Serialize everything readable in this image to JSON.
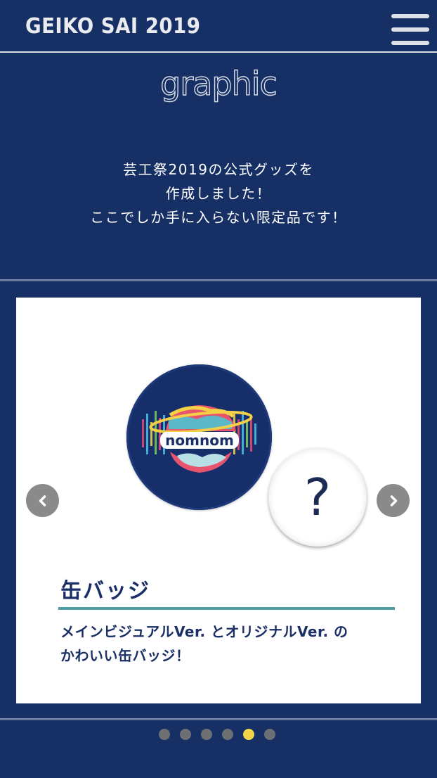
{
  "header": {
    "site_title": "GEIKO SAI 2019",
    "menu_icon": "hamburger-menu-icon"
  },
  "section": {
    "heading": "graphic",
    "intro_lines": [
      "芸工祭2019の公式グッズを",
      "作成しました！",
      "ここでしか手に入らない限定品です！"
    ]
  },
  "carousel": {
    "prev_icon": "chevron-left-icon",
    "next_icon": "chevron-right-icon",
    "item": {
      "badge_text": "nomnom",
      "mystery_symbol": "?",
      "title": "缶バッジ",
      "description_lines": [
        "メインビジュアルVer. とオリジナルVer. の",
        "かわいい缶バッジ！"
      ]
    },
    "total_slides": 6,
    "active_slide": 5
  },
  "colors": {
    "background": "#163066",
    "accent_rule": "#4e9ea5",
    "active_dot": "#f2d44a",
    "inactive_dot": "#6d6f73"
  }
}
